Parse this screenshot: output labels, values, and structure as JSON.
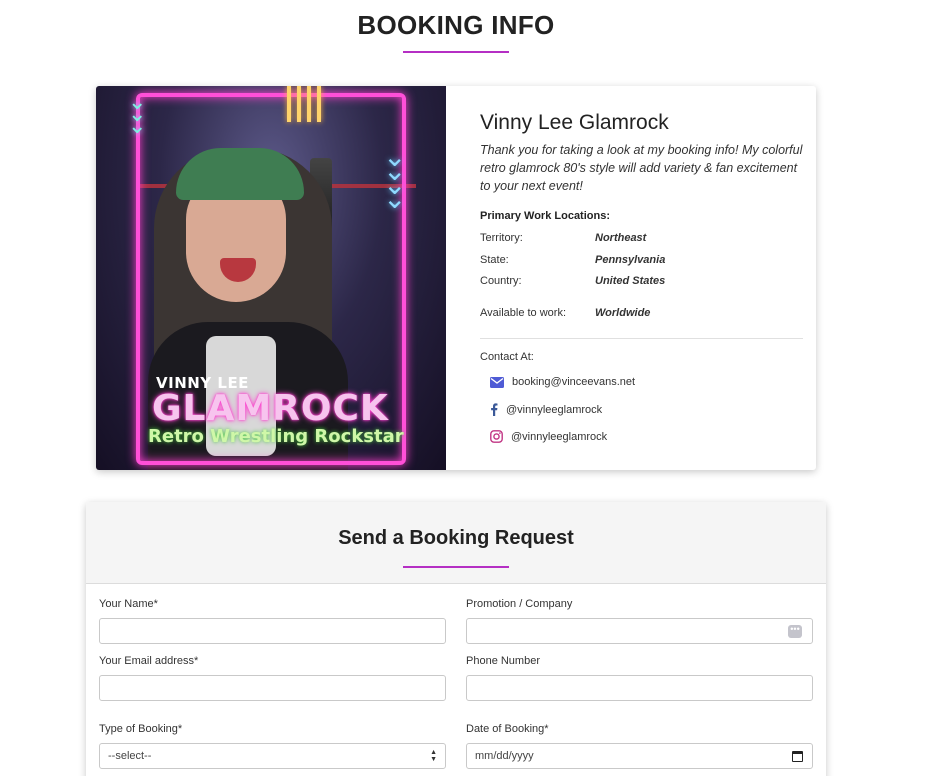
{
  "page": {
    "title": "BOOKING INFO",
    "accent_color": "#b52fc4"
  },
  "profile": {
    "photo": {
      "alt_icon": "wrestler-promo-photo",
      "name_line1": "VINNY LEE",
      "name_line2": "GLAMROCK",
      "tagline": "Retro Wrestling Rockstar"
    },
    "name": "Vinny Lee Glamrock",
    "description": "Thank you for taking a look at my booking info! My colorful retro glamrock 80's style will add variety & fan excitement to your next event!",
    "locations_heading": "Primary Work Locations:",
    "locations": [
      {
        "key": "Territory:",
        "value": "Northeast"
      },
      {
        "key": "State:",
        "value": "Pennsylvania"
      },
      {
        "key": "Country:",
        "value": "United States"
      }
    ],
    "available": {
      "key": "Available to work:",
      "value": "Worldwide"
    },
    "contact_heading": "Contact At:",
    "contacts": [
      {
        "icon": "envelope-icon",
        "text": "booking@vinceevans.net",
        "color": "#4f5bd5"
      },
      {
        "icon": "facebook-icon",
        "text": "@vinnyleeglamrock",
        "color": "#3b5998"
      },
      {
        "icon": "instagram-icon",
        "text": "@vinnyleeglamrock",
        "color": "#c13584"
      }
    ]
  },
  "form": {
    "title": "Send a Booking Request",
    "fields": {
      "name": {
        "label": "Your Name*",
        "value": ""
      },
      "company": {
        "label": "Promotion / Company",
        "value": ""
      },
      "email": {
        "label": "Your Email address*",
        "value": ""
      },
      "phone": {
        "label": "Phone Number",
        "value": ""
      },
      "type": {
        "label": "Type of Booking*",
        "selected": "--select--"
      },
      "date": {
        "label": "Date of Booking*",
        "placeholder": "mm/dd/yyyy"
      }
    }
  }
}
